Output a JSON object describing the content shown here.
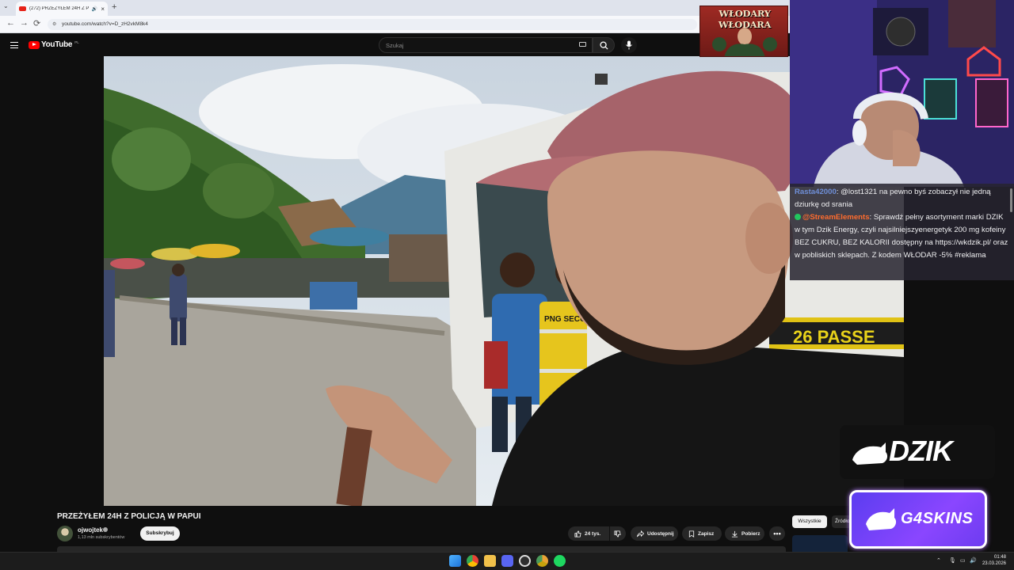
{
  "browser": {
    "tab_title": "(272) PRZEŻYŁEM 24H Z PO...",
    "tab_close": "×",
    "new_tab": "+",
    "tab_list": "⌄",
    "back": "←",
    "forward": "→",
    "reload": "⟳",
    "url": "youtube.com/watch?v=D_zH2vkM8k4"
  },
  "youtube": {
    "logo_text": "YouTube",
    "region": "PL",
    "search_placeholder": "Szukaj",
    "video_title": "PRZEŻYŁEM 24H Z POLICJĄ W PAPUI",
    "channel_name": "ojwojtek",
    "subscribers": "1,13 mln subskrybentów",
    "subscribe_label": "Subskrybuj",
    "likes": "24 tys.",
    "share_label": "Udostępnij",
    "save_label": "Zapisz",
    "download_label": "Pobierz",
    "more_label": "•••",
    "chips": [
      "Wszystkie",
      "Źródło"
    ]
  },
  "video_scene": {
    "sign_text": "26 PASSE",
    "vest_text": "PNG SECURITY"
  },
  "stream": {
    "chat": [
      {
        "user": "Rasta42000",
        "text": ": @lost1321 na pewno byś zobaczył nie jedną dziurkę od srania"
      },
      {
        "user": "@StreamElements",
        "text": ": Sprawdź pełny asortyment marki DZIK w tym Dzik Energy, czyli najsilniejszyenergetyk 200 mg kofeiny BEZ CUKRU, BEZ KALORII dostępny na https://wkdzik.pl/ oraz w pobliskich sklepach. Z kodem WŁODAR -5% #reklama"
      }
    ],
    "banner_wlodary": "WŁODARY WŁODARA",
    "banner_dzik": "DZIK",
    "banner_g4": "G4SKINS",
    "accent_g4": "#7b42f6",
    "accent_youtube": "#ff0000"
  },
  "taskbar": {
    "time": "01:48",
    "date": "23.03.2026",
    "icons": [
      "windows-start-icon",
      "chrome-icon",
      "file-explorer-icon",
      "discord-icon",
      "obs-icon",
      "chrome-canary-icon",
      "spotify-icon"
    ]
  }
}
